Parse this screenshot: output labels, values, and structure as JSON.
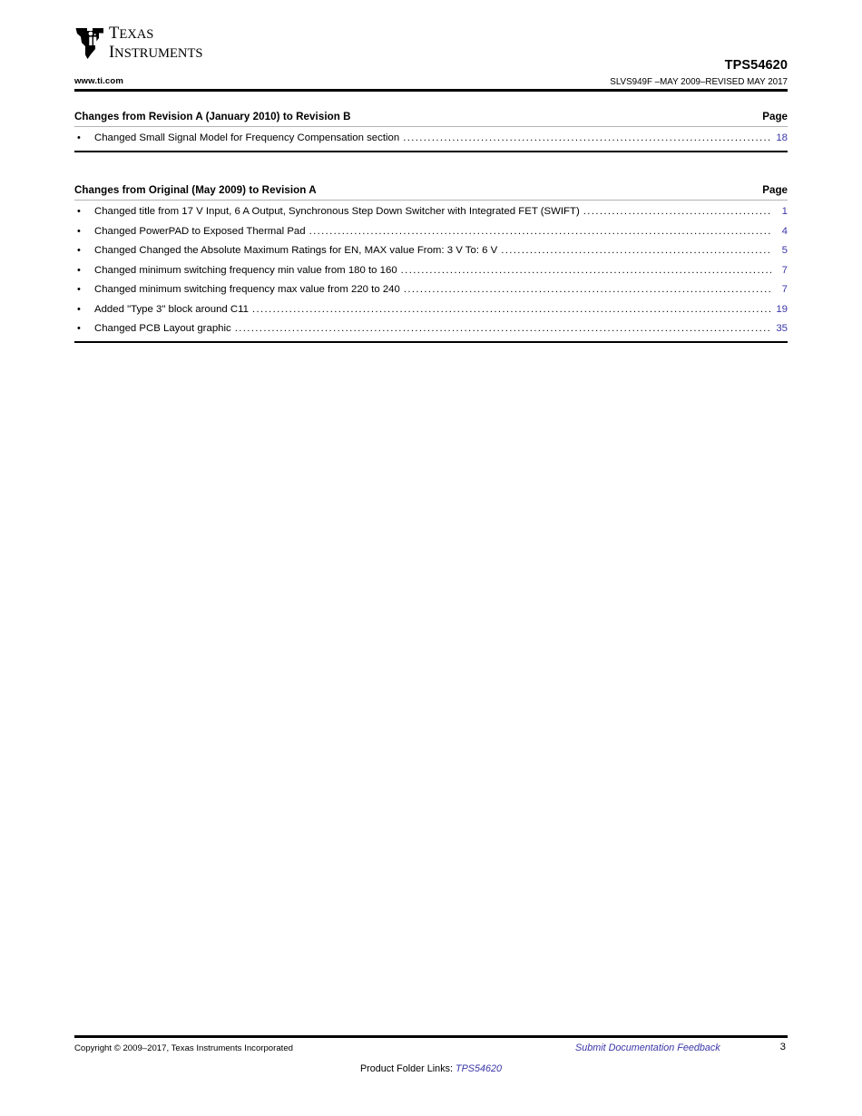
{
  "header": {
    "logo": {
      "icon": "ti-texas-logo-icon",
      "line1": "Texas",
      "line2": "Instruments"
    },
    "part_number": "TPS54620",
    "ti_url": "www.ti.com",
    "doc_id": "SLVS949F –MAY 2009–REVISED MAY 2017"
  },
  "colors": {
    "link": "#3a36a8",
    "rule_thick": "#000000",
    "rule_thin": "#b3b3b3"
  },
  "sections": [
    {
      "title": "Changes from Revision A (January 2010) to Revision B",
      "page_label": "Page",
      "rows": [
        {
          "bullet": "•",
          "text": "Changed Small Signal Model for Frequency Compensation section",
          "page": "18"
        }
      ]
    },
    {
      "title": "Changes from Original (May 2009) to Revision A",
      "page_label": "Page",
      "rows": [
        {
          "bullet": "•",
          "text": "Changed title from 17 V Input, 6 A Output, Synchronous Step Down Switcher with Integrated FET (SWIFT)",
          "page": "1"
        },
        {
          "bullet": "•",
          "text": "Changed PowerPAD to Exposed Thermal Pad",
          "page": "4"
        },
        {
          "bullet": "•",
          "text": "Changed Changed the Absolute Maximum Ratings for EN, MAX value From: 3 V To: 6 V",
          "page": "5"
        },
        {
          "bullet": "•",
          "text": "Changed minimum switching frequency min value from 180 to 160",
          "page": "7"
        },
        {
          "bullet": "•",
          "text": "Changed minimum switching frequency max value from 220 to 240",
          "page": "7"
        },
        {
          "bullet": "•",
          "text": "Added \"Type 3\" block around C11",
          "page": "19"
        },
        {
          "bullet": "•",
          "text": "Changed PCB Layout graphic",
          "page": "35"
        }
      ]
    }
  ],
  "footer": {
    "copyright": "Copyright © 2009–2017, Texas Instruments Incorporated",
    "feedback_link": "Submit Documentation Feedback",
    "page_number": "3",
    "product_folder_label": "Product Folder Links:",
    "product_folder_link": "TPS54620"
  }
}
